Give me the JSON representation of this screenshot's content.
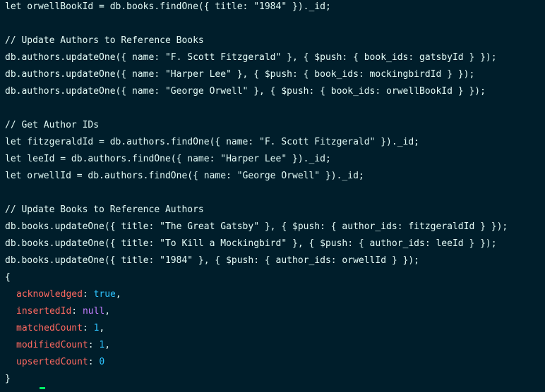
{
  "terminal": {
    "lines": [
      "let orwellBookId = db.books.findOne({ title: \"1984\" })._id;",
      "",
      "// Update Authors to Reference Books",
      "db.authors.updateOne({ name: \"F. Scott Fitzgerald\" }, { $push: { book_ids: gatsbyId } });",
      "db.authors.updateOne({ name: \"Harper Lee\" }, { $push: { book_ids: mockingbirdId } });",
      "db.authors.updateOne({ name: \"George Orwell\" }, { $push: { book_ids: orwellBookId } });",
      "",
      "// Get Author IDs",
      "let fitzgeraldId = db.authors.findOne({ name: \"F. Scott Fitzgerald\" })._id;",
      "let leeId = db.authors.findOne({ name: \"Harper Lee\" })._id;",
      "let orwellId = db.authors.findOne({ name: \"George Orwell\" })._id;",
      "",
      "// Update Books to Reference Authors",
      "db.books.updateOne({ title: \"The Great Gatsby\" }, { $push: { author_ids: fitzgeraldId } });",
      "db.books.updateOne({ title: \"To Kill a Mockingbird\" }, { $push: { author_ids: leeId } });",
      "db.books.updateOne({ title: \"1984\" }, { $push: { author_ids: orwellId } });"
    ],
    "result": {
      "open_brace": "{",
      "close_brace": "}",
      "fields": [
        {
          "key": "acknowledged",
          "value": "true",
          "type": "bool"
        },
        {
          "key": "insertedId",
          "value": "null",
          "type": "null"
        },
        {
          "key": "matchedCount",
          "value": "1",
          "type": "num"
        },
        {
          "key": "modifiedCount",
          "value": "1",
          "type": "num"
        },
        {
          "key": "upsertedCount",
          "value": "0",
          "type": "num"
        }
      ]
    }
  },
  "colors": {
    "background": "#001e2b",
    "text": "#e3fcf7",
    "key": "#ff6960",
    "number": "#2dc4ff",
    "null": "#c27eff",
    "cursor": "#00ed64"
  }
}
